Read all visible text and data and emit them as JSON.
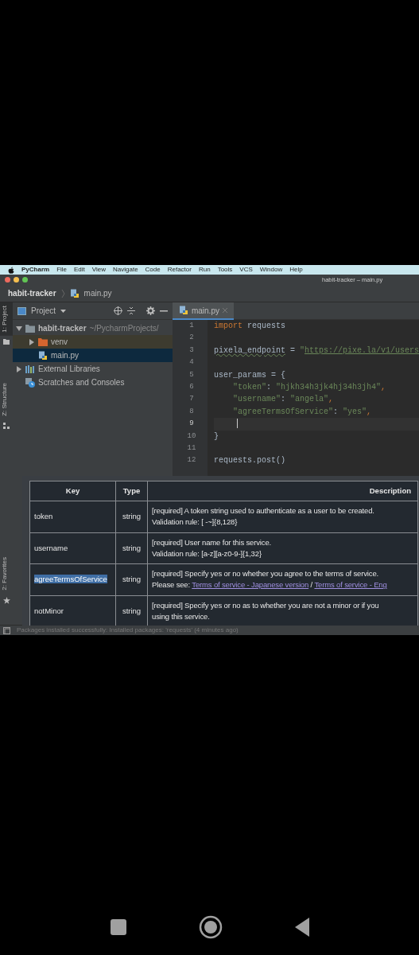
{
  "os_menu": {
    "app": "PyCharm",
    "items": [
      "File",
      "Edit",
      "View",
      "Navigate",
      "Code",
      "Refactor",
      "Run",
      "Tools",
      "VCS",
      "Window",
      "Help"
    ]
  },
  "window": {
    "title": "habit-tracker – main.py"
  },
  "breadcrumb": [
    "habit-tracker",
    "main.py"
  ],
  "tool_strip": [
    {
      "label": "1: Project",
      "selected": true,
      "kind": "folder"
    },
    {
      "label": "Z: Structure",
      "selected": false,
      "kind": "structure"
    },
    {
      "label": "2: Favorites",
      "selected": false,
      "kind": "star"
    }
  ],
  "project_panel": {
    "title": "Project",
    "tree": [
      {
        "label": "habit-tracker",
        "path": "~/PycharmProjects/",
        "kind": "folder",
        "expanded": true,
        "selected": false,
        "children": [
          {
            "label": "venv",
            "kind": "excluded_folder",
            "expanded": false,
            "selected": false
          },
          {
            "label": "main.py",
            "kind": "file",
            "selected": true
          }
        ]
      },
      {
        "label": "External Libraries",
        "kind": "library",
        "expanded": false,
        "selected": false
      },
      {
        "label": "Scratches and Consoles",
        "kind": "scratches",
        "selected": false
      }
    ]
  },
  "editor": {
    "tabs": [
      {
        "label": "main.py",
        "selected": true
      }
    ],
    "lines": [
      {
        "number": "1",
        "current": false,
        "tokens": [
          {
            "text": "import",
            "kind": "keyword"
          },
          {
            "text": " requests",
            "kind": "plain"
          }
        ]
      },
      {
        "number": "2",
        "current": false
      },
      {
        "number": "3",
        "current": false,
        "tokens": [
          {
            "text": "pixela_endpoint",
            "kind": "typo"
          },
          {
            "text": " = ",
            "kind": "plain"
          },
          {
            "text": "\"",
            "kind": "string"
          },
          {
            "text": "https://pixe.la/v1/users",
            "kind": "url"
          }
        ]
      },
      {
        "number": "4",
        "current": false
      },
      {
        "number": "5",
        "current": false,
        "tokens": [
          {
            "text": "user_params = {",
            "kind": "plain"
          }
        ]
      },
      {
        "number": "6",
        "current": false,
        "tokens": [
          {
            "text": "    \"token\"",
            "kind": "string"
          },
          {
            "text": ": ",
            "kind": "plain"
          },
          {
            "text": "\"hjkh34h3jk4hj34h3jh4\"",
            "kind": "string"
          },
          {
            "text": ",",
            "kind": "keyword"
          }
        ]
      },
      {
        "number": "7",
        "current": false,
        "tokens": [
          {
            "text": "    \"username\"",
            "kind": "string"
          },
          {
            "text": ": ",
            "kind": "plain"
          },
          {
            "text": "\"angela\"",
            "kind": "string"
          },
          {
            "text": ",",
            "kind": "keyword"
          }
        ]
      },
      {
        "number": "8",
        "current": false,
        "tokens": [
          {
            "text": "    \"agreeTermsOfService\"",
            "kind": "string"
          },
          {
            "text": ": ",
            "kind": "plain"
          },
          {
            "text": "\"yes\"",
            "kind": "string"
          },
          {
            "text": ",",
            "kind": "keyword"
          }
        ]
      },
      {
        "number": "9",
        "current": true
      },
      {
        "number": "10",
        "current": false,
        "tokens": [
          {
            "text": "}",
            "kind": "plain"
          }
        ]
      },
      {
        "number": "11",
        "current": false
      },
      {
        "number": "12",
        "current": false,
        "tokens": [
          {
            "text": "requests.post()",
            "kind": "plain"
          }
        ]
      }
    ]
  },
  "docs_table": {
    "columns": [
      "Key",
      "Type",
      "Description"
    ],
    "rows": [
      {
        "key": "token",
        "highlighted": false,
        "type": "string",
        "description": [
          [
            {
              "text": "[required] A token string used to authenticate as a user to be created.",
              "kind": "text"
            }
          ],
          [
            {
              "text": "Validation rule: [ -~]{8,128}",
              "kind": "text"
            }
          ]
        ]
      },
      {
        "key": "username",
        "highlighted": false,
        "type": "string",
        "description": [
          [
            {
              "text": "[required] User name for this service.",
              "kind": "text"
            }
          ],
          [
            {
              "text": "Validation rule: [a-z][a-z0-9-]{1,32}",
              "kind": "text"
            }
          ]
        ]
      },
      {
        "key": "agreeTermsOfService",
        "highlighted": true,
        "type": "string",
        "description": [
          [
            {
              "text": "[required] Specify yes or no whether you agree to the terms of service.",
              "kind": "text"
            }
          ],
          [
            {
              "text": "Please see: ",
              "kind": "text"
            },
            {
              "text": "Terms of service - Japanese version",
              "kind": "link"
            },
            {
              "text": " / ",
              "kind": "text"
            },
            {
              "text": "Terms of service - Eng",
              "kind": "link"
            }
          ]
        ]
      },
      {
        "key": "notMinor",
        "highlighted": false,
        "type": "string",
        "description": [
          [
            {
              "text": "[required] Specify yes or no as to whether you are not a minor or if you",
              "kind": "text"
            }
          ],
          [
            {
              "text": "using this service.",
              "kind": "text"
            }
          ]
        ]
      }
    ]
  },
  "status_bar": {
    "message": "Packages installed successfully: Installed packages: 'requests' (4 minutes ago)"
  }
}
